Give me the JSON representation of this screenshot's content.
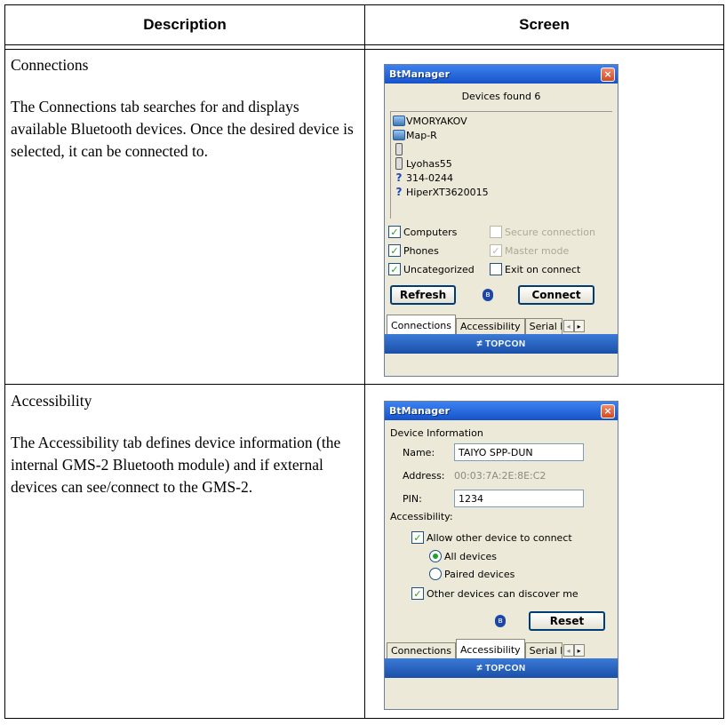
{
  "table": {
    "headers": [
      "Description",
      "Screen"
    ]
  },
  "rows": [
    {
      "title": "Connections",
      "description": "The Connections tab searches for and displays available Bluetooth devices. Once the desired device is selected, it can be connected to."
    },
    {
      "title": "Accessibility",
      "description": "The Accessibility tab defines device information (the internal GMS-2 Bluetooth module) and if external devices can see/connect to the GMS-2."
    }
  ],
  "screen1": {
    "title": "BtManager",
    "close": "×",
    "devices_found": "Devices found 6",
    "devices": [
      {
        "name": "VMORYAKOV",
        "icon": "computer-icon"
      },
      {
        "name": "Map-R",
        "icon": "computer-icon"
      },
      {
        "name": "",
        "icon": "phone-icon"
      },
      {
        "name": "Lyohas55",
        "icon": "phone-icon"
      },
      {
        "name": "314-0244",
        "icon": "unknown-device-icon"
      },
      {
        "name": "HiperXT3620015",
        "icon": "unknown-device-icon"
      }
    ],
    "checks": {
      "computers": "Computers",
      "secure": "Secure connection",
      "phones": "Phones",
      "master": "Master mode",
      "uncategorized": "Uncategorized",
      "exit": "Exit on connect"
    },
    "check_mark": "✓",
    "refresh": "Refresh",
    "connect": "Connect",
    "bt": "ʙ",
    "tabs": {
      "connections": "Connections",
      "accessibility": "Accessibility",
      "serial": "Serial P"
    },
    "left_arrow": "◂",
    "right_arrow": "▸",
    "brand": "TOPCON",
    "brand_mark": "≠"
  },
  "screen2": {
    "title": "BtManager",
    "close": "×",
    "device_info": "Device Information",
    "name_label": "Name:",
    "name_value": "TAIYO SPP-DUN",
    "address_label": "Address:",
    "address_value": "00:03:7A:2E:8E:C2",
    "pin_label": "PIN:",
    "pin_value": "1234",
    "accessibility_label": "Accessibility:",
    "allow": "Allow other device to connect",
    "all_devices": "All devices",
    "paired_devices": "Paired devices",
    "discover": "Other devices can discover me",
    "check_mark": "✓",
    "reset": "Reset",
    "bt": "ʙ",
    "tabs": {
      "connections": "Connections",
      "accessibility": "Accessibility",
      "serial": "Serial P"
    },
    "left_arrow": "◂",
    "right_arrow": "▸",
    "brand": "TOPCON",
    "brand_mark": "≠"
  },
  "colors": {
    "titlebar": "#2563dc",
    "dialog_bg": "#ECE9D8",
    "check": "#21a121",
    "footer": "#1a4fa8"
  }
}
